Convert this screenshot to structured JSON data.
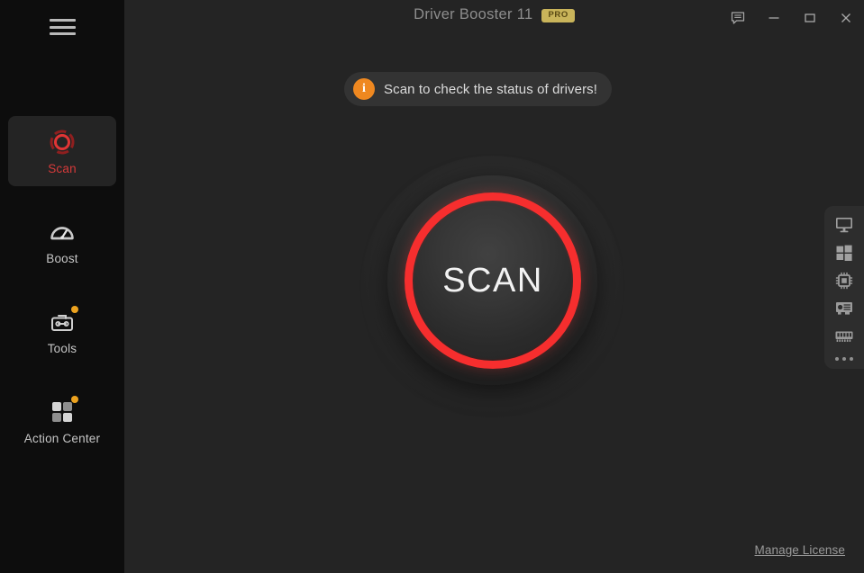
{
  "window": {
    "title": "Driver Booster 11",
    "pro_badge": "PRO",
    "controls": {
      "feedback": "feedback-icon",
      "minimize": "minimize-icon",
      "maximize": "maximize-icon",
      "close": "close-icon"
    }
  },
  "sidebar": {
    "menu_icon": "hamburger-menu-icon",
    "items": [
      {
        "label": "Scan",
        "icon": "scan-icon",
        "active": true,
        "badge": false
      },
      {
        "label": "Boost",
        "icon": "speedometer-icon",
        "active": false,
        "badge": false
      },
      {
        "label": "Tools",
        "icon": "toolbox-icon",
        "active": false,
        "badge": true
      },
      {
        "label": "Action Center",
        "icon": "grid-squares-icon",
        "active": false,
        "badge": true
      }
    ]
  },
  "banner": {
    "icon": "info-icon",
    "icon_glyph": "i",
    "text": "Scan to check the status of drivers!"
  },
  "scan_button": {
    "label": "SCAN"
  },
  "dock": {
    "items": [
      {
        "name": "monitor-icon"
      },
      {
        "name": "windows-logo-icon"
      },
      {
        "name": "cpu-chip-icon"
      },
      {
        "name": "graphics-card-icon"
      },
      {
        "name": "memory-ram-icon"
      }
    ],
    "more": "more-options-icon"
  },
  "footer": {
    "manage_license": "Manage License"
  },
  "colors": {
    "sidebar_bg": "#0d0d0d",
    "main_bg": "#242424",
    "accent_red": "#f62e2e",
    "active_label_red": "#d63a3a",
    "badge_orange": "#eca21f",
    "info_orange": "#ef8820",
    "pro_gold": "#c9b45a",
    "dock_bg": "#2d2d2d",
    "banner_bg": "#333333"
  }
}
